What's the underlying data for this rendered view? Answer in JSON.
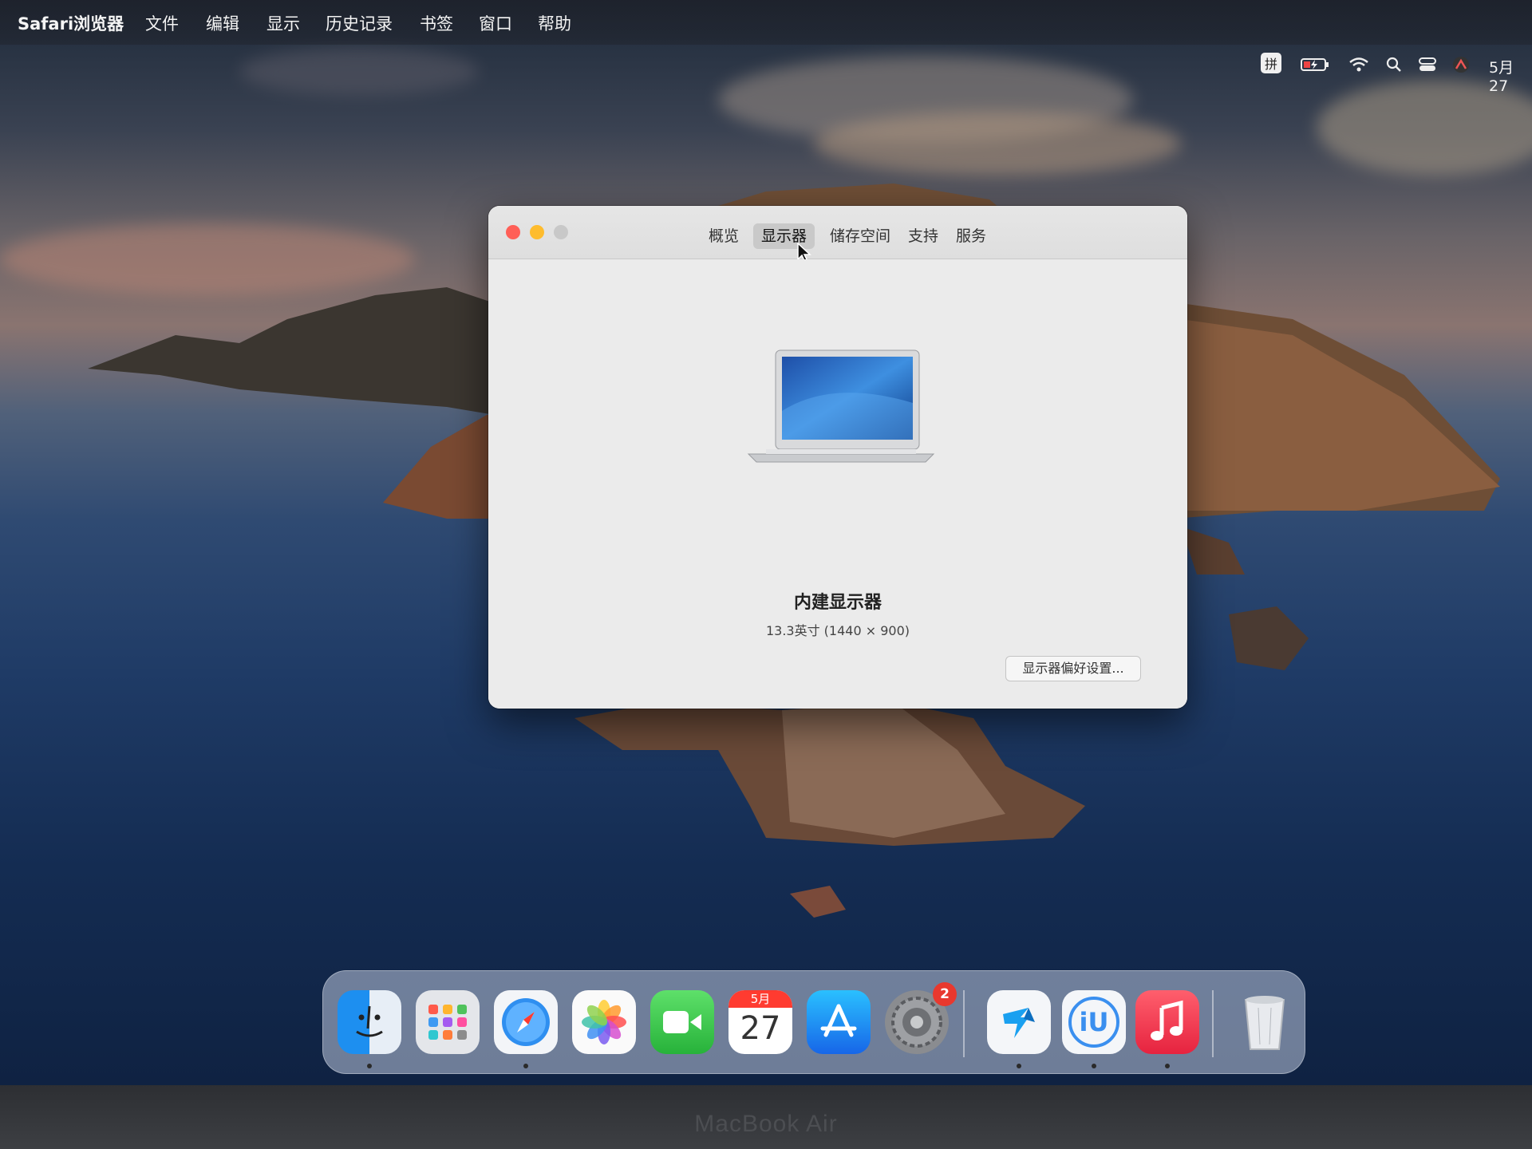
{
  "menubar": {
    "app_name": "Safari浏览器",
    "items": [
      "文件",
      "编辑",
      "显示",
      "历史记录",
      "书签",
      "窗口",
      "帮助"
    ],
    "status_icons": [
      "input-method-icon",
      "battery-charging-icon",
      "wifi-icon",
      "spotlight-icon",
      "control-center-icon",
      "user-icon"
    ],
    "input_method_label": "拼",
    "date": "5月27"
  },
  "about_window": {
    "tabs": [
      "概览",
      "显示器",
      "储存空间",
      "支持",
      "服务"
    ],
    "active_tab": "显示器",
    "display_name": "内建显示器",
    "display_size": "13.3英寸 (1440 × 900)",
    "preferences_button": "显示器偏好设置..."
  },
  "dock": {
    "apps": [
      {
        "name": "Finder",
        "icon": "finder-icon"
      },
      {
        "name": "Launchpad",
        "icon": "launchpad-icon"
      },
      {
        "name": "Safari",
        "icon": "safari-icon"
      },
      {
        "name": "Photos",
        "icon": "photos-icon"
      },
      {
        "name": "FaceTime",
        "icon": "facetime-icon"
      },
      {
        "name": "Calendar",
        "icon": "calendar-icon",
        "month": "5月",
        "day": "27"
      },
      {
        "name": "App Store",
        "icon": "app-store-icon"
      },
      {
        "name": "System Preferences",
        "icon": "system-preferences-icon",
        "badge": "2"
      },
      {
        "name": "TestFlight-like",
        "icon": "arrow-app-icon"
      },
      {
        "name": "iU",
        "icon": "iu-app-icon",
        "label": "iU"
      },
      {
        "name": "Music",
        "icon": "music-icon"
      },
      {
        "name": "Trash",
        "icon": "trash-icon"
      }
    ]
  },
  "bezel_label": "MacBook Air",
  "colors": {
    "close": "#ff5f57",
    "minimize": "#febc2e",
    "zoom": "#c8c8c8",
    "badge": "#e8382e"
  }
}
